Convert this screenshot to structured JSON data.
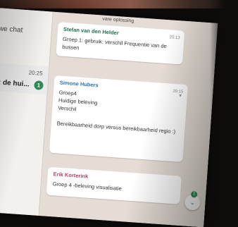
{
  "photo": {
    "subject": "projected chat app screen"
  },
  "top_partial_text": "vare oplossing",
  "left_pane": {
    "header_fragment": "we chat",
    "chat_item": {
      "time": "20:25",
      "preview": "t: de hui...",
      "unread_count": "1"
    }
  },
  "messages": [
    {
      "sender": "Stefan van den Helder",
      "sender_color": "#1f6f4a",
      "lines": [
        "Groep 1: gebruik: verschil Frequentie van de bussen"
      ],
      "time": "20:13"
    },
    {
      "sender": "Simone Hubers",
      "sender_color": "#2d73b5",
      "lines": [
        "Groep4",
        "Huidige beleving",
        "Verschil",
        "",
        "Bereikbaarheid dorp versus bereikbaarheid regio :)"
      ],
      "time": "20:15"
    },
    {
      "sender": "Erik Korterink",
      "sender_color": "#b0406a",
      "lines": [
        "Groep 4 -beleving visualisatie"
      ],
      "time": ""
    }
  ],
  "scroll_button": {
    "badge": "1"
  }
}
